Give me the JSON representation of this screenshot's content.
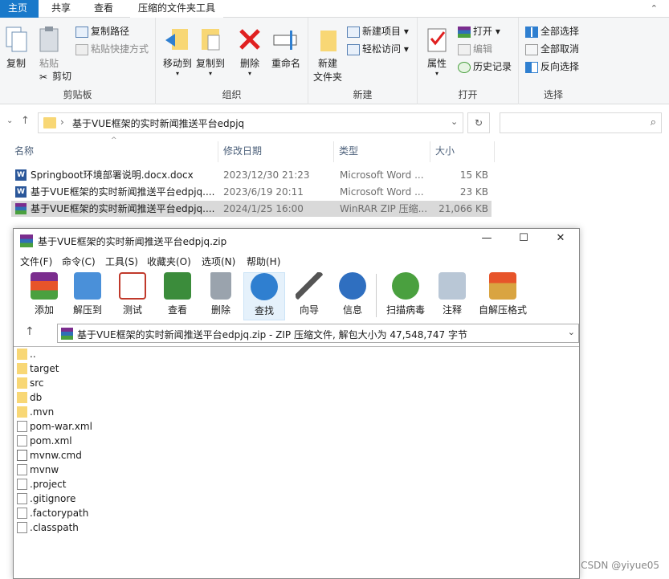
{
  "ribbon_tabs": {
    "file": "主页",
    "home": "共享",
    "share": "查看",
    "tools": "压缩的文件夹工具"
  },
  "ribbon": {
    "clipboard": {
      "copy": "复制",
      "paste": "粘贴",
      "copy_path": "复制路径",
      "paste_shortcut": "粘贴快捷方式",
      "cut": "剪切",
      "label": "剪贴板"
    },
    "organize": {
      "move_to": "移动到",
      "copy_to": "复制到",
      "delete": "删除",
      "rename": "重命名",
      "label": "组织"
    },
    "new": {
      "new_folder": "新建\n文件夹",
      "new_item": "新建项目",
      "easy_access": "轻松访问",
      "label": "新建"
    },
    "open": {
      "properties": "属性",
      "open": "打开",
      "edit": "编辑",
      "history": "历史记录",
      "label": "打开"
    },
    "select": {
      "select_all": "全部选择",
      "select_none": "全部取消",
      "invert": "反向选择",
      "label": "选择"
    }
  },
  "address": {
    "path": "基于VUE框架的实时新闻推送平台edpjq"
  },
  "columns": {
    "name": "名称",
    "date": "修改日期",
    "type": "类型",
    "size": "大小"
  },
  "files": [
    {
      "name": "Springboot环境部署说明.docx.docx",
      "date": "2023/12/30 21:23",
      "type": "Microsoft Word ...",
      "size": "15 KB",
      "icon": "word-icon"
    },
    {
      "name": "基于VUE框架的实时新闻推送平台edpjq....",
      "date": "2023/6/19 20:11",
      "type": "Microsoft Word ...",
      "size": "23 KB",
      "icon": "word-icon"
    },
    {
      "name": "基于VUE框架的实时新闻推送平台edpjq....",
      "date": "2024/1/25 16:00",
      "type": "WinRAR ZIP 压缩...",
      "size": "21,066 KB",
      "icon": "winrar-icon"
    }
  ],
  "winrar": {
    "title": "基于VUE框架的实时新闻推送平台edpjq.zip",
    "menus": [
      "文件(F)",
      "命令(C)",
      "工具(S)",
      "收藏夹(O)",
      "选项(N)",
      "帮助(H)"
    ],
    "toolbar": [
      "添加",
      "解压到",
      "测试",
      "查看",
      "删除",
      "查找",
      "向导",
      "信息",
      "扫描病毒",
      "注释",
      "自解压格式"
    ],
    "path_text": "基于VUE框架的实时新闻推送平台edpjq.zip - ZIP 压缩文件, 解包大小为 47,548,747 字节",
    "entries": [
      {
        "name": "..",
        "kind": "folder"
      },
      {
        "name": "target",
        "kind": "folder"
      },
      {
        "name": "src",
        "kind": "folder"
      },
      {
        "name": "db",
        "kind": "folder"
      },
      {
        "name": ".mvn",
        "kind": "folder"
      },
      {
        "name": "pom-war.xml",
        "kind": "xml"
      },
      {
        "name": "pom.xml",
        "kind": "xml"
      },
      {
        "name": "mvnw.cmd",
        "kind": "cmd"
      },
      {
        "name": "mvnw",
        "kind": "file"
      },
      {
        "name": ".project",
        "kind": "file"
      },
      {
        "name": ".gitignore",
        "kind": "file"
      },
      {
        "name": ".factorypath",
        "kind": "file"
      },
      {
        "name": ".classpath",
        "kind": "file"
      }
    ]
  },
  "watermark": "CSDN @yiyue05"
}
